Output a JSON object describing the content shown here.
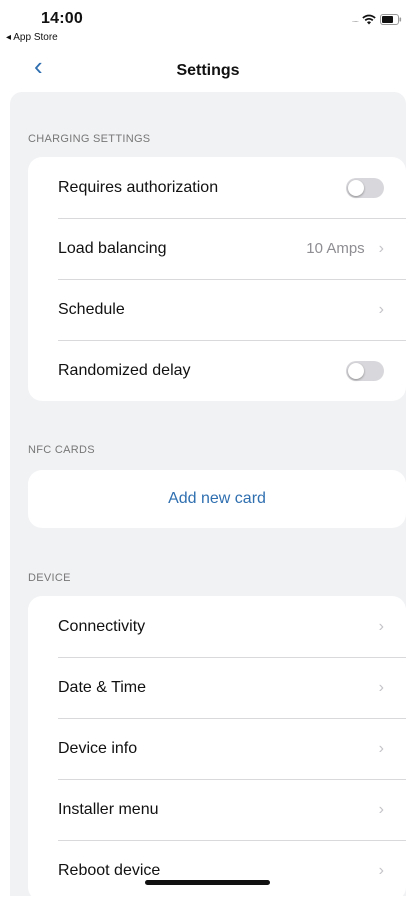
{
  "status_bar": {
    "time": "14:00",
    "back_app": "◂ App Store",
    "signal": "....."
  },
  "nav": {
    "title": "Settings",
    "back_glyph": "‹"
  },
  "sections": {
    "charging": {
      "header": "CHARGING SETTINGS",
      "rows": [
        {
          "label": "Requires authorization",
          "type": "toggle",
          "on": false
        },
        {
          "label": "Load balancing",
          "value": "10 Amps",
          "type": "chevron"
        },
        {
          "label": "Schedule",
          "type": "chevron"
        },
        {
          "label": "Randomized delay",
          "type": "toggle",
          "on": false
        }
      ]
    },
    "nfc": {
      "header": "NFC CARDS",
      "add_label": "Add new card"
    },
    "device": {
      "header": "DEVICE",
      "rows": [
        {
          "label": "Connectivity",
          "type": "chevron"
        },
        {
          "label": "Date & Time",
          "type": "chevron"
        },
        {
          "label": "Device info",
          "type": "chevron"
        },
        {
          "label": "Installer menu",
          "type": "chevron"
        },
        {
          "label": "Reboot device",
          "type": "chevron"
        }
      ]
    }
  },
  "icons": {
    "chevron": "›"
  },
  "colors": {
    "accent": "#2f6fb0",
    "background": "#f1f2f4",
    "card": "#ffffff",
    "toggle_off": "#d8d8dc"
  }
}
